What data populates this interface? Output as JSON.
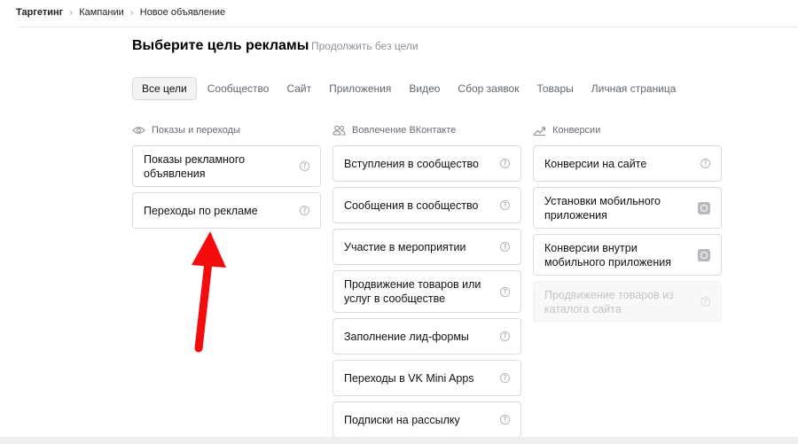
{
  "breadcrumb": [
    "Таргетинг",
    "Кампании",
    "Новое объявление"
  ],
  "header": {
    "title": "Выберите цель рекламы",
    "skip_link": "Продолжить без цели"
  },
  "tabs": [
    "Все цели",
    "Сообщество",
    "Сайт",
    "Приложения",
    "Видео",
    "Сбор заявок",
    "Товары",
    "Личная страница"
  ],
  "active_tab": "Все цели",
  "columns": [
    {
      "title": "Показы и переходы",
      "icon": "eye-icon",
      "items": [
        {
          "label": "Показы рекламного объявления"
        },
        {
          "label": "Переходы по рекламе"
        }
      ]
    },
    {
      "title": "Вовлечение ВКонтакте",
      "icon": "users-icon",
      "items": [
        {
          "label": "Вступления в сообщество"
        },
        {
          "label": "Сообщения в сообщество"
        },
        {
          "label": "Участие в мероприятии"
        },
        {
          "label": "Продвижение товаров или услуг в сообществе"
        },
        {
          "label": "Заполнение лид-формы"
        },
        {
          "label": "Переходы в VK Mini Apps"
        },
        {
          "label": "Подписки на рассылку"
        }
      ]
    },
    {
      "title": "Конверсии",
      "icon": "trend-icon",
      "items": [
        {
          "label": "Конверсии на сайте"
        },
        {
          "label": "Установки мобильного приложения"
        },
        {
          "label": "Конверсии внутри мобильного приложения"
        },
        {
          "label": "Продвижение товаров из каталога сайта"
        }
      ]
    }
  ],
  "help_glyph": "?",
  "colors": {
    "annotation_arrow": "#f40b0b",
    "card_border": "#d9dce0",
    "muted_text": "#8d9399"
  }
}
